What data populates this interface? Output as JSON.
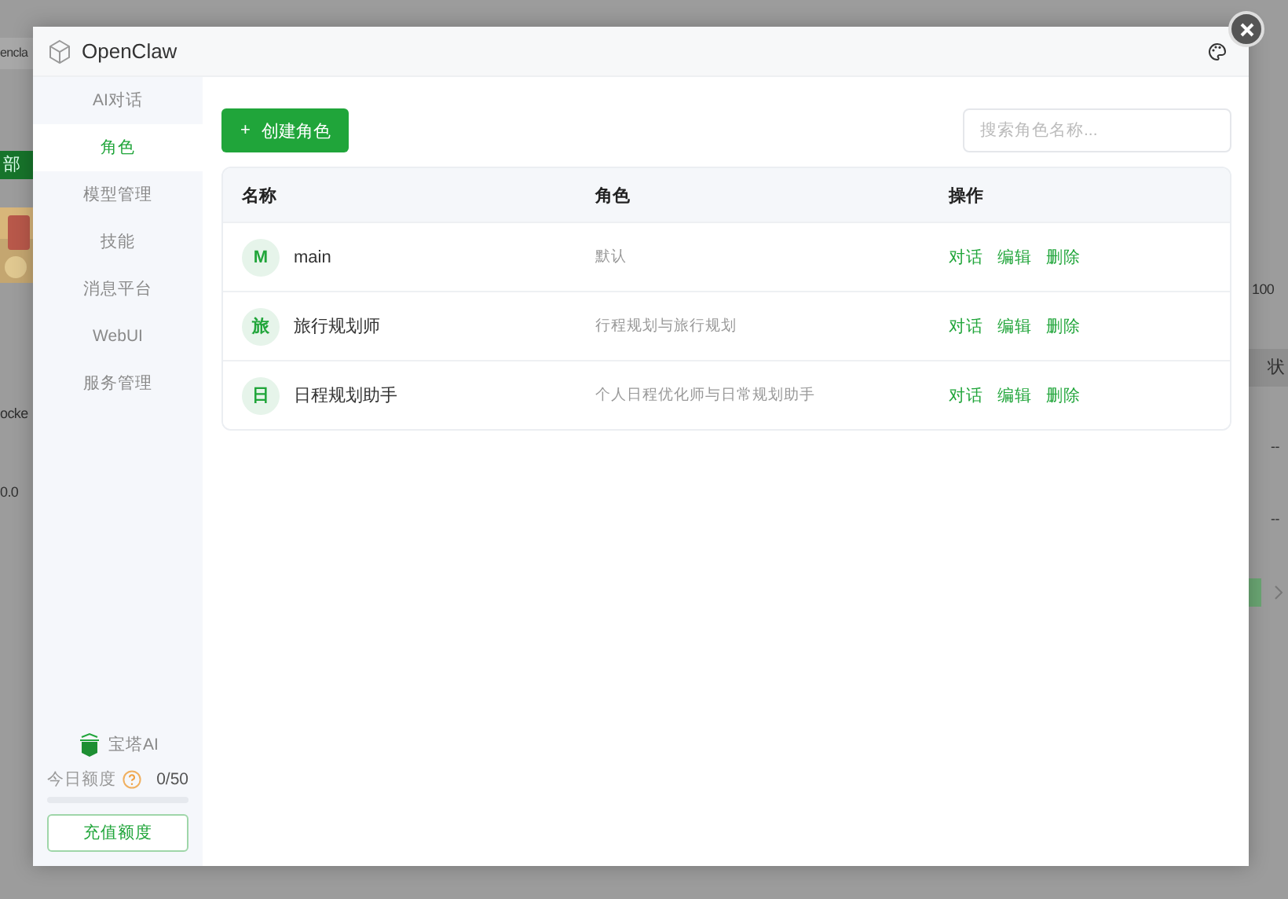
{
  "background": {
    "left": [
      {
        "kind": "tab",
        "text": "encla"
      },
      {
        "kind": "button",
        "text": "部"
      },
      {
        "kind": "picture"
      },
      {
        "kind": "text",
        "text": "ocke"
      },
      {
        "kind": "text",
        "text": "0.0"
      }
    ],
    "right": [
      {
        "kind": "text",
        "text": "100"
      },
      {
        "kind": "header",
        "text": "状"
      },
      {
        "kind": "text",
        "text": "--"
      },
      {
        "kind": "text",
        "text": "--"
      },
      {
        "kind": "pager"
      }
    ]
  },
  "window": {
    "title": "OpenClaw"
  },
  "sidebar": {
    "items": [
      {
        "label": "AI对话",
        "selected": false
      },
      {
        "label": "角色",
        "selected": true
      },
      {
        "label": "模型管理",
        "selected": false
      },
      {
        "label": "技能",
        "selected": false
      },
      {
        "label": "消息平台",
        "selected": false
      },
      {
        "label": "WebUI",
        "selected": false
      },
      {
        "label": "服务管理",
        "selected": false
      }
    ],
    "brand": "宝塔AI",
    "quota": {
      "label": "今日额度",
      "reading": "0/50",
      "level": 0
    },
    "recharge": "充值额度"
  },
  "toolbar": {
    "create": "创建角色",
    "plus": "+",
    "search": {
      "placeholder": "搜索角色名称..."
    }
  },
  "table": {
    "columns": [
      "名称",
      "角色",
      "操作"
    ],
    "rows": [
      {
        "avatar": "M",
        "name": "main",
        "role": "默认",
        "actions": [
          "对话",
          "编辑",
          "删除"
        ]
      },
      {
        "avatar": "旅",
        "name": "旅行规划师",
        "role": "行程规划与旅行规划",
        "actions": [
          "对话",
          "编辑",
          "删除"
        ]
      },
      {
        "avatar": "日",
        "name": "日程规划助手",
        "role": "个人日程优化师与日常规划助手",
        "actions": [
          "对话",
          "编辑",
          "删除"
        ]
      }
    ]
  }
}
